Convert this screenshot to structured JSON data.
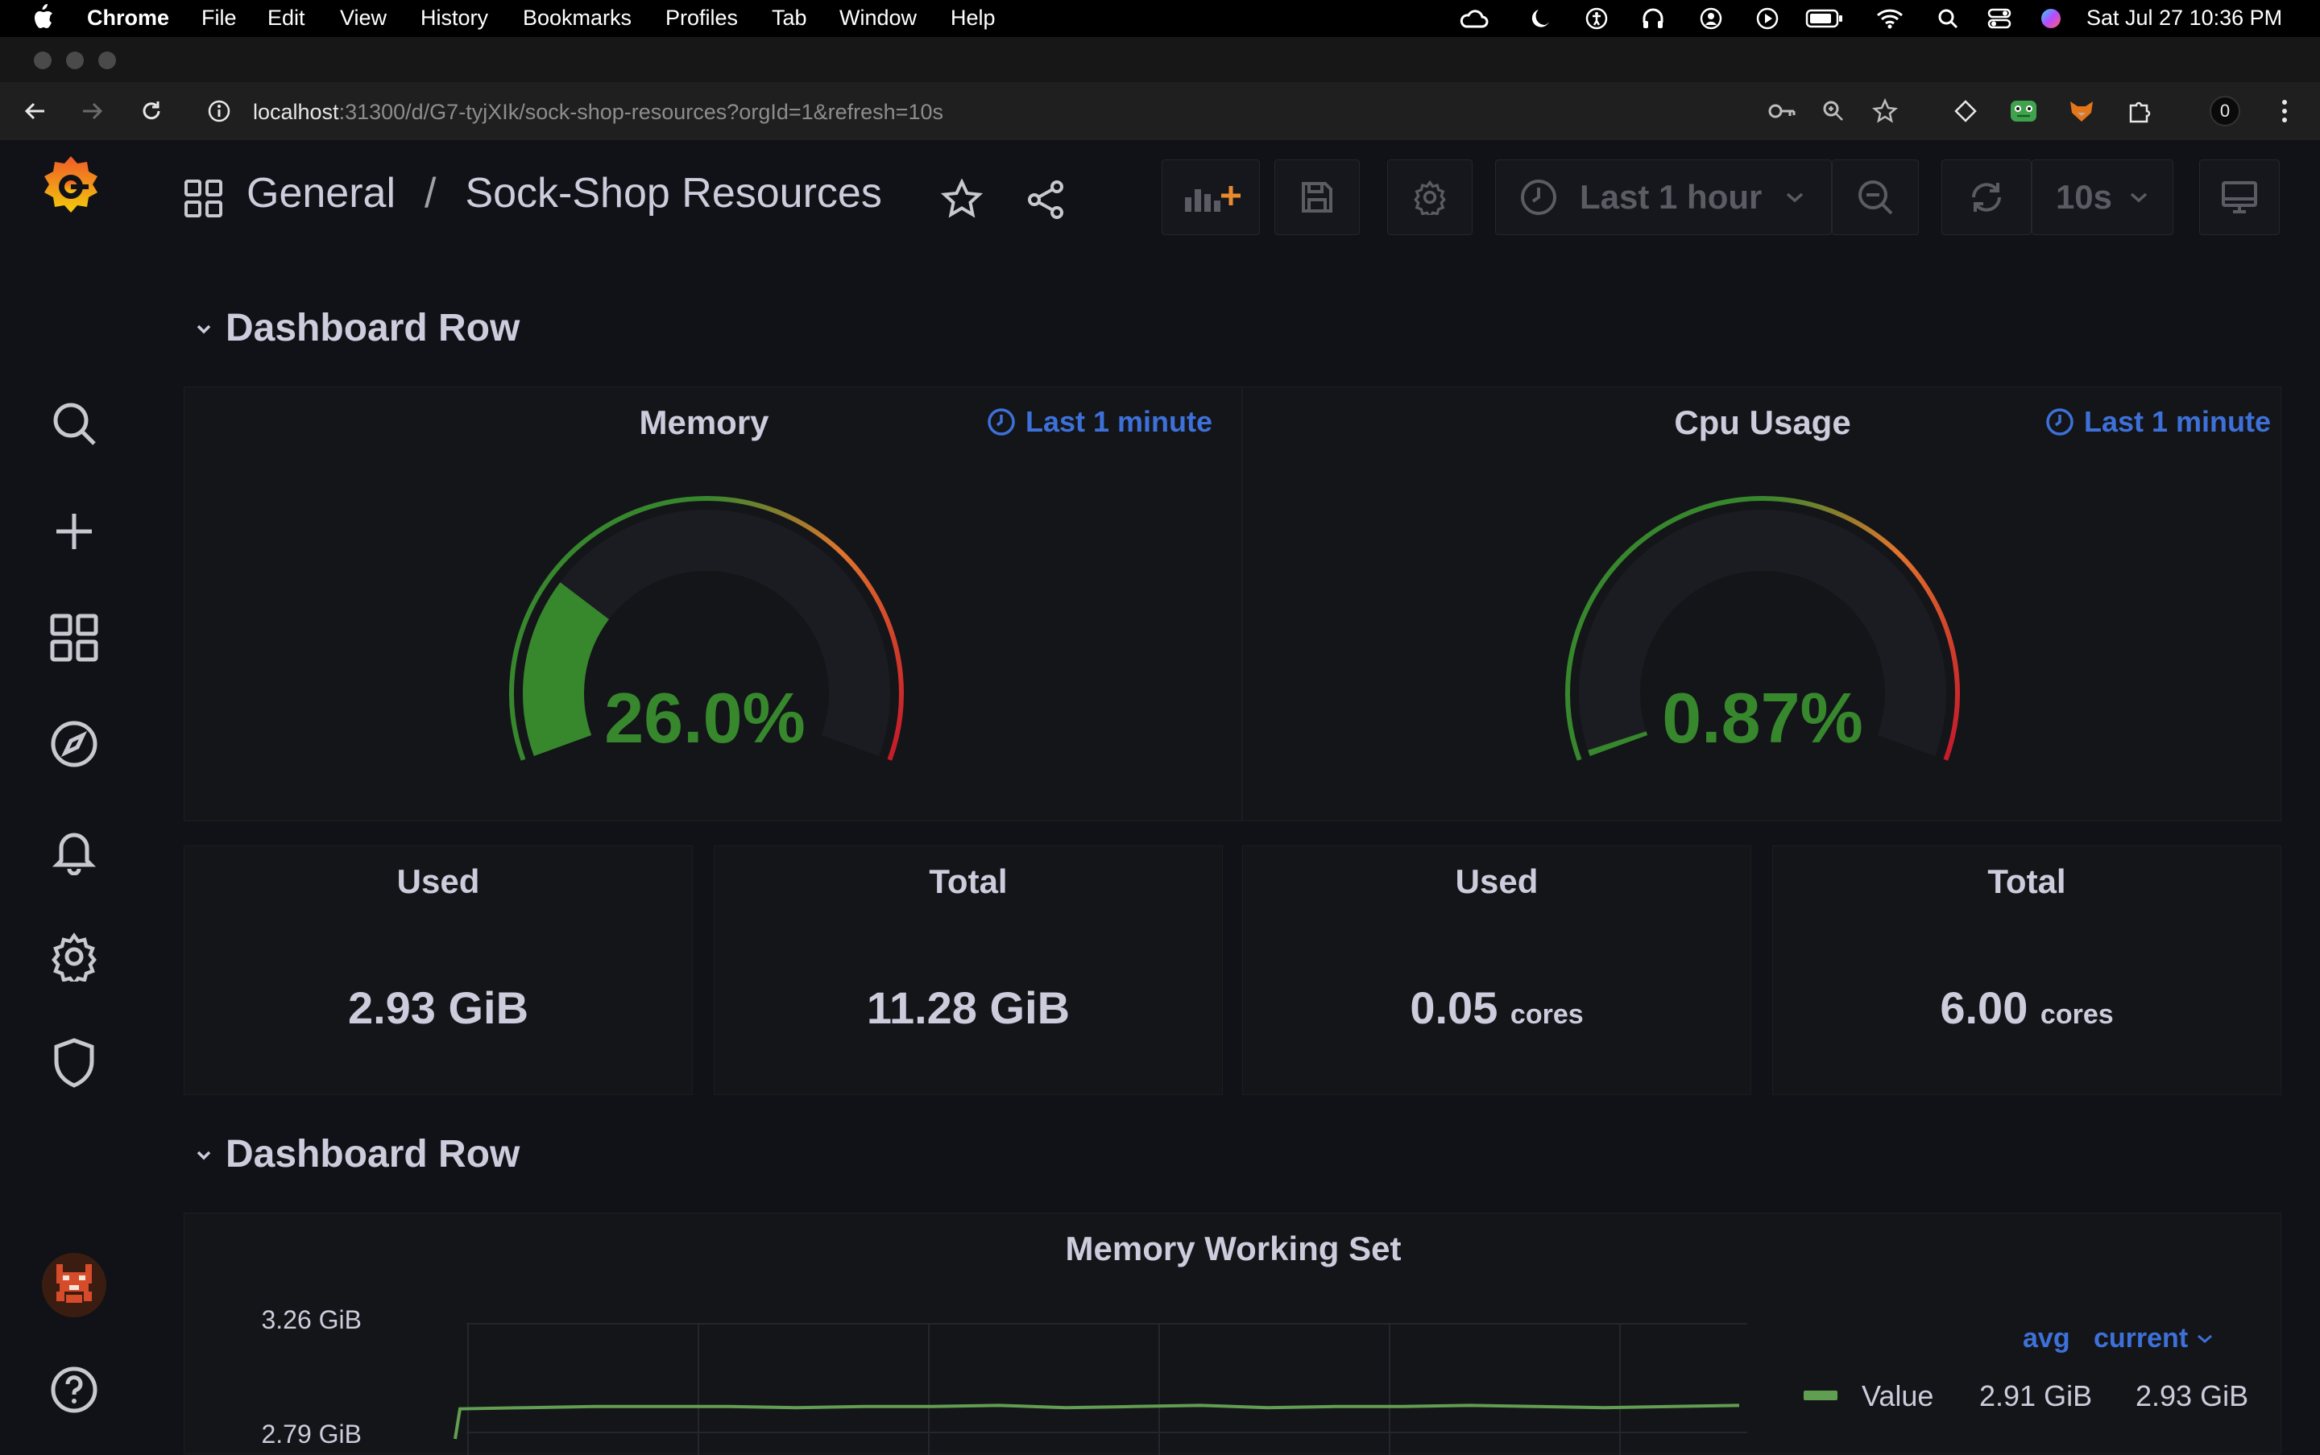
{
  "menubar": {
    "apple_icon": "apple-icon",
    "items": [
      "Chrome",
      "File",
      "Edit",
      "View",
      "History",
      "Bookmarks",
      "Profiles",
      "Tab",
      "Window",
      "Help"
    ],
    "datetime": "Sat Jul 27  10:36 PM"
  },
  "browser": {
    "url_host": "localhost",
    "url_rest": ":31300/d/G7-tyjXIk/sock-shop-resources?orgId=1&refresh=10s",
    "profile_badge": "0"
  },
  "dashboard": {
    "folder": "General",
    "separator": "/",
    "title": "Sock-Shop Resources",
    "time_range": "Last 1 hour",
    "refresh_interval": "10s"
  },
  "rows": [
    {
      "title": "Dashboard Row"
    },
    {
      "title": "Dashboard Row"
    }
  ],
  "gauges": [
    {
      "title": "Memory",
      "time_override": "Last 1 minute",
      "value_text": "26.0%",
      "value_fraction": 0.26
    },
    {
      "title": "Cpu Usage",
      "time_override": "Last 1 minute",
      "value_text": "0.87%",
      "value_fraction": 0.0087
    }
  ],
  "stats": [
    {
      "label": "Used",
      "value": "2.93 GiB",
      "unit": ""
    },
    {
      "label": "Total",
      "value": "11.28 GiB",
      "unit": ""
    },
    {
      "label": "Used",
      "value": "0.05",
      "unit": "cores"
    },
    {
      "label": "Total",
      "value": "6.00",
      "unit": "cores"
    }
  ],
  "timeseries": {
    "title": "Memory Working Set",
    "legend_headers": [
      "avg",
      "current"
    ],
    "legend_series": {
      "name": "Value",
      "avg": "2.91 GiB",
      "current": "2.93 GiB"
    },
    "colors": {
      "series": "#629e51",
      "green": "#37872d",
      "orange": "#e0752d",
      "red": "#c4162a",
      "accent": "#3d71d9"
    }
  },
  "chart_data": {
    "type": "line",
    "title": "Memory Working Set",
    "ylabel": "",
    "ytick_labels": [
      "3.26 GiB",
      "2.79 GiB"
    ],
    "series": [
      {
        "name": "Value",
        "x_index": [
          0,
          1,
          2,
          3,
          4,
          5,
          6,
          7,
          8,
          9,
          10,
          11,
          12,
          13,
          14,
          15,
          16,
          17,
          18,
          19,
          20
        ],
        "values": [
          2.79,
          2.92,
          2.925,
          2.93,
          2.93,
          2.93,
          2.925,
          2.93,
          2.93,
          2.935,
          2.925,
          2.93,
          2.935,
          2.925,
          2.93,
          2.93,
          2.935,
          2.93,
          2.925,
          2.93,
          2.935
        ]
      }
    ],
    "ylim": [
      2.79,
      3.26
    ],
    "grid": true,
    "legend": "right"
  }
}
